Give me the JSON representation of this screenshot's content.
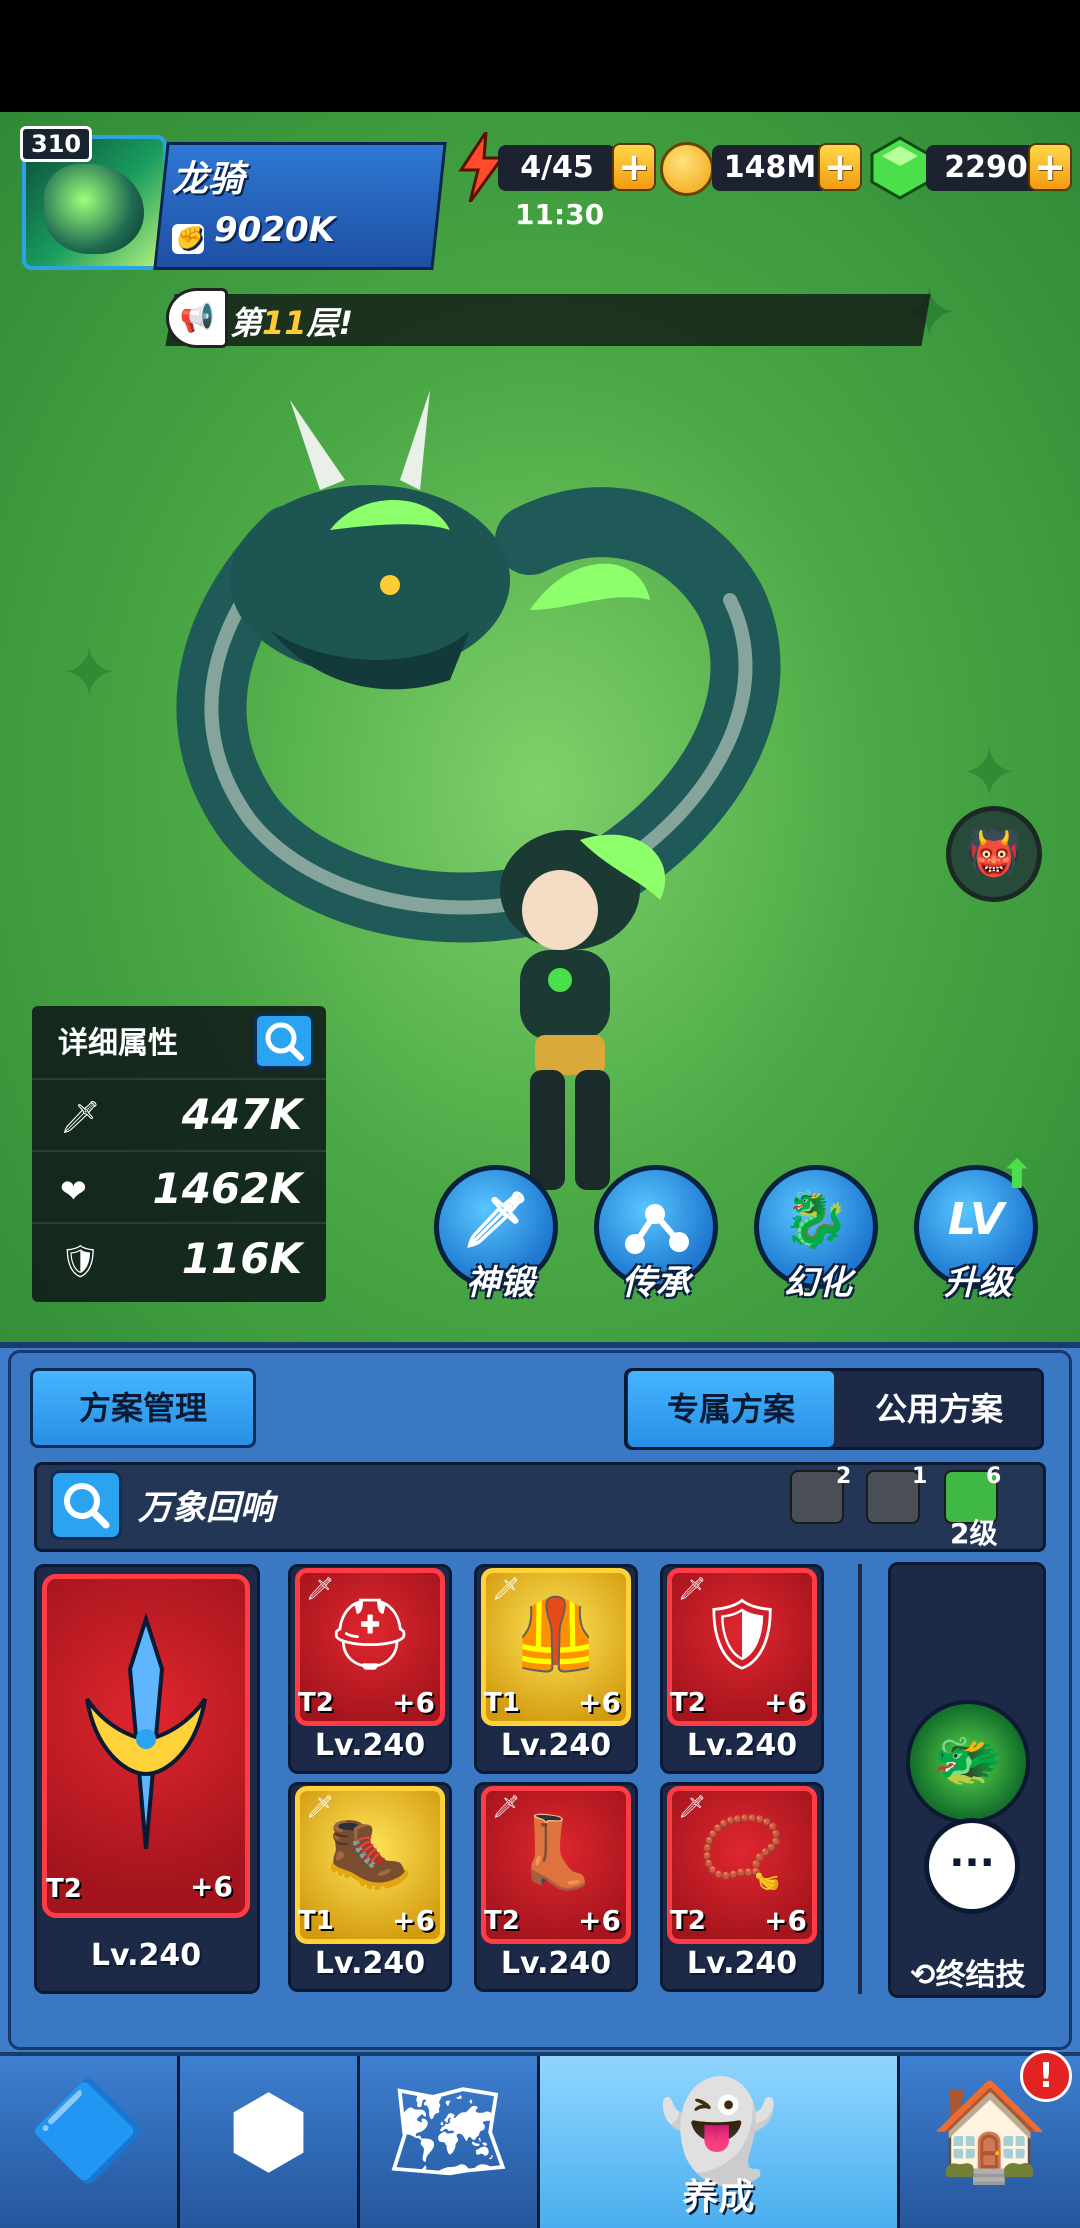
{
  "profile": {
    "level": "310",
    "name": "龙骑",
    "power": "9020K"
  },
  "resources": {
    "energy": "4/45",
    "energy_timer": "11:30",
    "coins": "148M",
    "gems": "2290",
    "plus": "+"
  },
  "announcement": {
    "prefix": "第",
    "highlight": "11",
    "suffix": "层!"
  },
  "stats": {
    "title": "详细属性",
    "attack": "447K",
    "hp": "1462K",
    "defense": "116K"
  },
  "actions": [
    {
      "label": "神锻",
      "icon": "sword-icon"
    },
    {
      "label": "传承",
      "icon": "link-icon"
    },
    {
      "label": "幻化",
      "icon": "dragon-icon"
    },
    {
      "label": "升级",
      "icon": "level-up-icon"
    }
  ],
  "level_glyph": "LV",
  "panel": {
    "scheme_manage": "方案管理",
    "tab_exclusive": "专属方案",
    "tab_public": "公用方案",
    "set_name": "万象回响",
    "set_counts": [
      "2",
      "1",
      "6"
    ],
    "set_level": "2级"
  },
  "equipment": {
    "main": {
      "tier": "T2",
      "plus": "+6",
      "level": "Lv.240"
    },
    "items": [
      {
        "tier": "T2",
        "plus": "+6",
        "level": "Lv.240",
        "rarity": "red",
        "icon": "helmet-icon"
      },
      {
        "tier": "T1",
        "plus": "+6",
        "level": "Lv.240",
        "rarity": "gold",
        "icon": "armor-icon"
      },
      {
        "tier": "T2",
        "plus": "+6",
        "level": "Lv.240",
        "rarity": "red",
        "icon": "shoulder-icon"
      },
      {
        "tier": "T1",
        "plus": "+6",
        "level": "Lv.240",
        "rarity": "gold",
        "icon": "boot-icon"
      },
      {
        "tier": "T2",
        "plus": "+6",
        "level": "Lv.240",
        "rarity": "red",
        "icon": "greaves-icon"
      },
      {
        "tier": "T2",
        "plus": "+6",
        "level": "Lv.240",
        "rarity": "red",
        "icon": "necklace-icon"
      }
    ]
  },
  "ultimate": {
    "label": "终结技"
  },
  "nav": {
    "active_label": "养成",
    "alert": "!"
  },
  "colors": {
    "accent_blue": "#2aa3f0",
    "gold": "#ffd23a",
    "red_rarity": "#ff3b46",
    "gem_green": "#4be04b"
  }
}
